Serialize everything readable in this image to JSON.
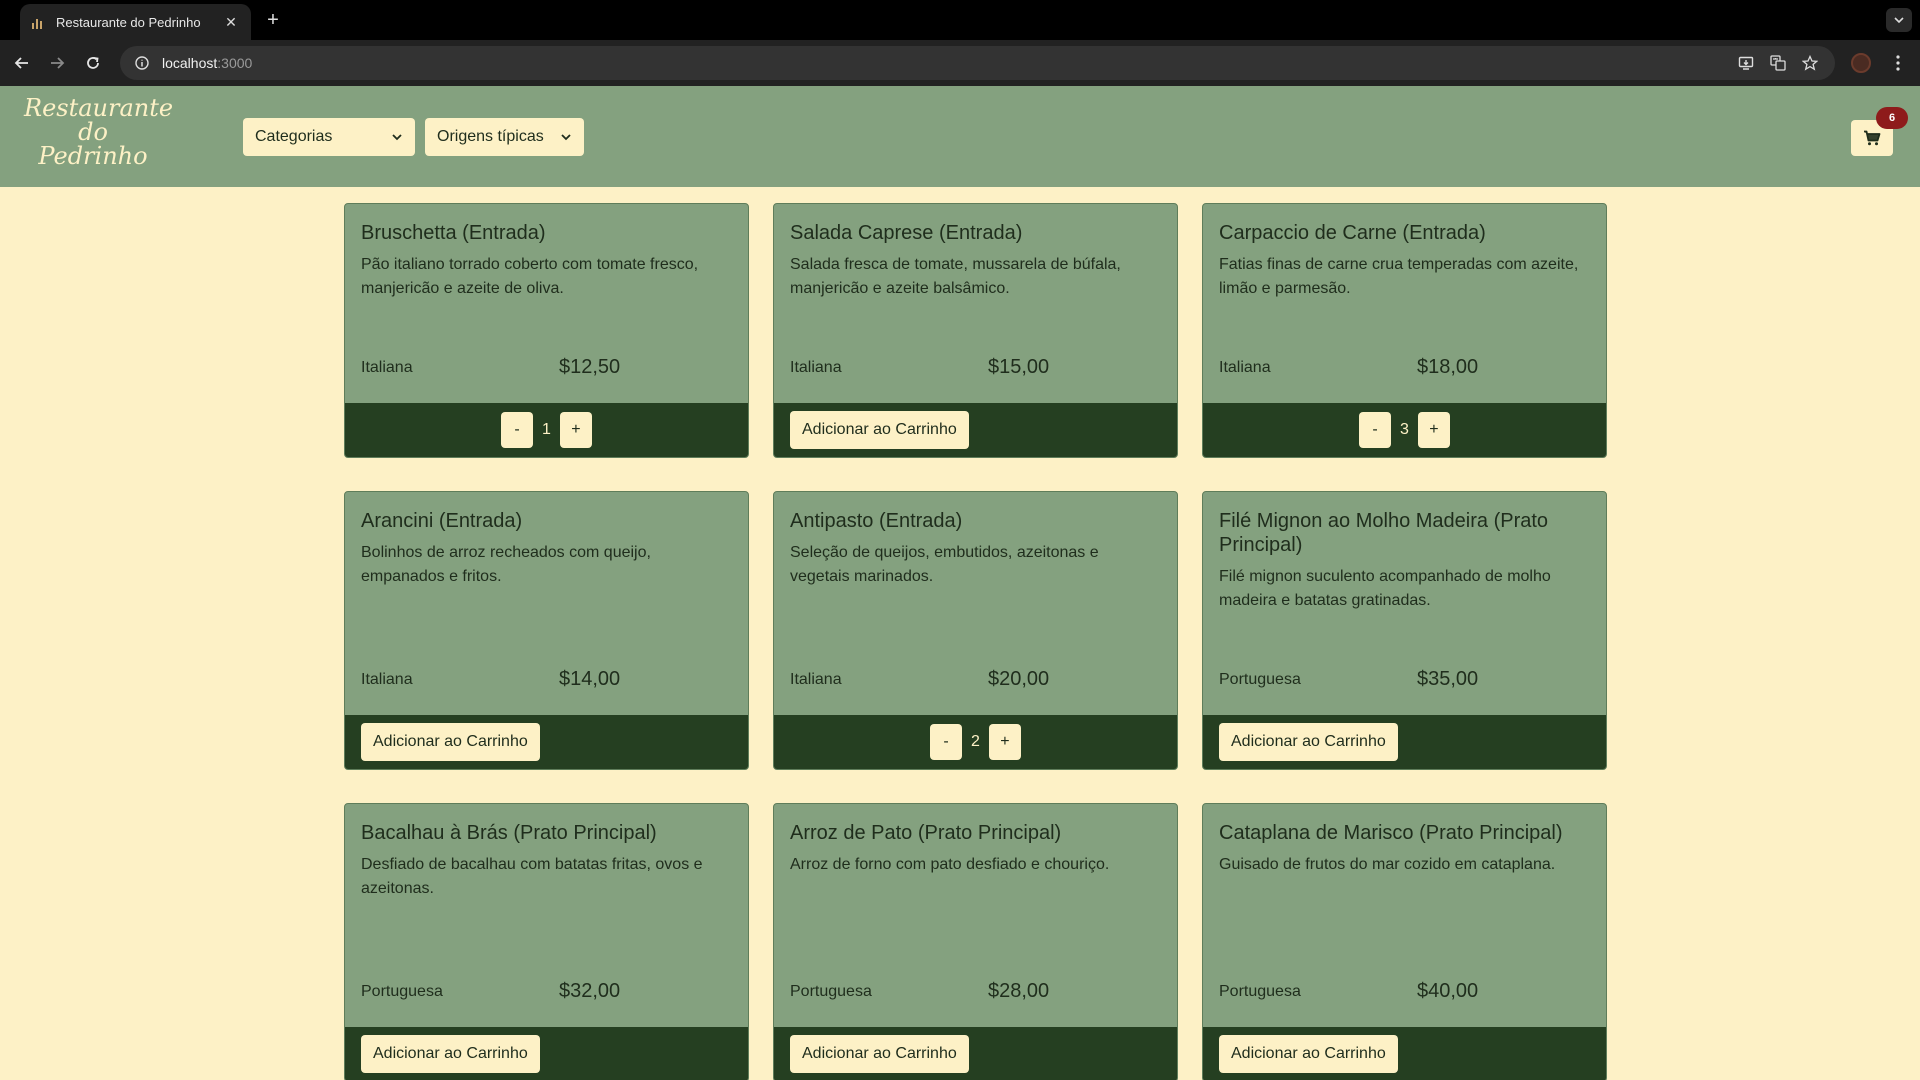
{
  "browser": {
    "tab_title": "Restaurante do Pedrinho",
    "tab_close": "✕",
    "new_tab": "+",
    "url_host": "localhost",
    "url_port": ":3000"
  },
  "header": {
    "logo_lines": [
      "Restaurante",
      "do",
      "Pedrinho"
    ],
    "dropdowns": [
      "Categorias",
      "Origens típicas"
    ],
    "cart_count": "6"
  },
  "colors": {
    "page_bg": "#fdf1c6",
    "header_bg": "#84a17f",
    "card_bg": "#84a17f",
    "card_footer_bg": "#253f21",
    "badge_bg": "#8e1b1b"
  },
  "icons": {
    "back": "arrow-left-icon",
    "forward": "arrow-right-icon",
    "reload": "reload-icon",
    "info": "info-icon",
    "cart": "cart-icon",
    "chevron": "chevron-down-icon"
  },
  "add_label": "Adicionar ao Carrinho",
  "qty_minus": "-",
  "qty_plus": "+",
  "products": [
    {
      "title": "Bruschetta (Entrada)",
      "description": "Pão italiano torrado coberto com tomate fresco, manjericão e azeite de oliva.",
      "origin": "Italiana",
      "price": "$12,50",
      "qty": "1"
    },
    {
      "title": "Salada Caprese (Entrada)",
      "description": "Salada fresca de tomate, mussarela de búfala, manjericão e azeite balsâmico.",
      "origin": "Italiana",
      "price": "$15,00"
    },
    {
      "title": "Carpaccio de Carne (Entrada)",
      "description": "Fatias finas de carne crua temperadas com azeite, limão e parmesão.",
      "origin": "Italiana",
      "price": "$18,00",
      "qty": "3"
    },
    {
      "title": "Arancini (Entrada)",
      "description": "Bolinhos de arroz recheados com queijo, empanados e fritos.",
      "origin": "Italiana",
      "price": "$14,00"
    },
    {
      "title": "Antipasto (Entrada)",
      "description": "Seleção de queijos, embutidos, azeitonas e vegetais marinados.",
      "origin": "Italiana",
      "price": "$20,00",
      "qty": "2"
    },
    {
      "title": "Filé Mignon ao Molho Madeira (Prato Principal)",
      "description": "Filé mignon suculento acompanhado de molho madeira e batatas gratinadas.",
      "origin": "Portuguesa",
      "price": "$35,00"
    },
    {
      "title": "Bacalhau à Brás (Prato Principal)",
      "description": "Desfiado de bacalhau com batatas fritas, ovos e azeitonas.",
      "origin": "Portuguesa",
      "price": "$32,00"
    },
    {
      "title": "Arroz de Pato (Prato Principal)",
      "description": "Arroz de forno com pato desfiado e chouriço.",
      "origin": "Portuguesa",
      "price": "$28,00"
    },
    {
      "title": "Cataplana de Marisco (Prato Principal)",
      "description": "Guisado de frutos do mar cozido em cataplana.",
      "origin": "Portuguesa",
      "price": "$40,00"
    }
  ]
}
